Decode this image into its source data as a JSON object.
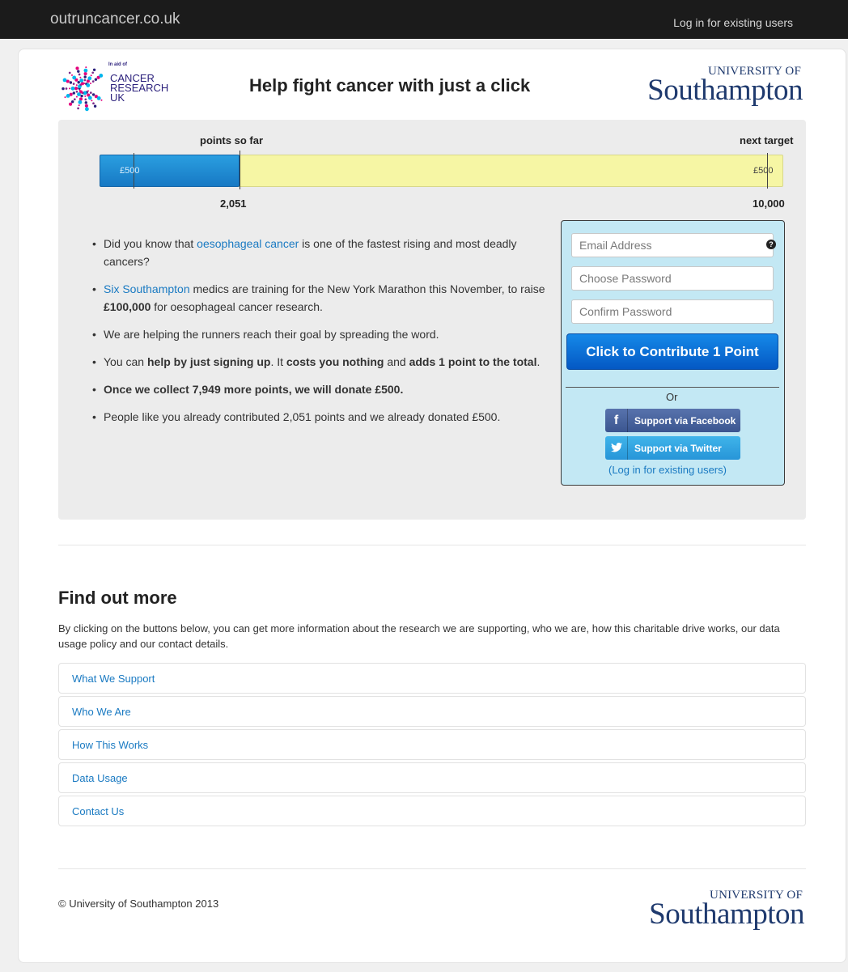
{
  "topbar": {
    "site_name": "outruncancer.co.uk",
    "login_link": "Log in for existing users"
  },
  "header": {
    "cru_logo": {
      "in_aid_of": "In aid of",
      "line1": "CANCER",
      "line2": "RESEARCH",
      "line3": "UK"
    },
    "headline": "Help fight cancer with just a click",
    "soton_logo": {
      "small": "UNIVERSITY OF",
      "big": "Southampton"
    }
  },
  "progress": {
    "label_current": "points so far",
    "label_target": "next target",
    "current_value": 2051,
    "current_display": "2,051",
    "target_value": 10000,
    "target_display": "10,000",
    "markers": [
      {
        "label": "£500",
        "at_points": 500
      },
      {
        "label": "£500",
        "at_points": 10000
      }
    ],
    "colors": {
      "fill": "#1779c4",
      "track": "#f6f6a4"
    }
  },
  "bullets": [
    {
      "parts": [
        {
          "t": "Did you know that "
        },
        {
          "t": "oesophageal cancer",
          "link": true
        },
        {
          "t": " is one of the fastest rising and most deadly cancers?"
        }
      ]
    },
    {
      "parts": [
        {
          "t": "Six Southampton",
          "link": true
        },
        {
          "t": " medics are training for the New York Marathon this November, to raise "
        },
        {
          "t": "£100,000",
          "bold": true
        },
        {
          "t": " for oesophageal cancer research."
        }
      ]
    },
    {
      "parts": [
        {
          "t": "We are helping the runners reach their goal by spreading the word."
        }
      ]
    },
    {
      "parts": [
        {
          "t": "You can "
        },
        {
          "t": "help by just signing up",
          "bold": true
        },
        {
          "t": ". It "
        },
        {
          "t": "costs you nothing",
          "bold": true
        },
        {
          "t": " and "
        },
        {
          "t": "adds 1 point to the total",
          "bold": true
        },
        {
          "t": "."
        }
      ]
    },
    {
      "parts": [
        {
          "t": "Once we collect 7,949 more points, we will donate £500.",
          "bold": true
        }
      ]
    },
    {
      "parts": [
        {
          "t": "People like you already contributed 2,051 points and we already donated £500."
        }
      ]
    }
  ],
  "signup": {
    "email_placeholder": "Email Address",
    "password_placeholder": "Choose Password",
    "confirm_placeholder": "Confirm Password",
    "help_icon": "?",
    "contribute_label": "Click to Contribute 1 Point",
    "or_text": "Or",
    "facebook_label": "Support via Facebook",
    "facebook_icon": "f",
    "twitter_label": "Support via Twitter",
    "twitter_icon": "🐦",
    "login_link": "(Log in for existing users)"
  },
  "find_out_more": {
    "title": "Find out more",
    "description": "By clicking on the buttons below, you can get more information about the research we are supporting, who we are, how this charitable drive works, our data usage policy and our contact details.",
    "items": [
      "What We Support",
      "Who We Are",
      "How This Works",
      "Data Usage",
      "Contact Us"
    ]
  },
  "footer": {
    "copyright": "© University of Southampton 2013",
    "soton_logo": {
      "small": "UNIVERSITY OF",
      "big": "Southampton"
    }
  }
}
